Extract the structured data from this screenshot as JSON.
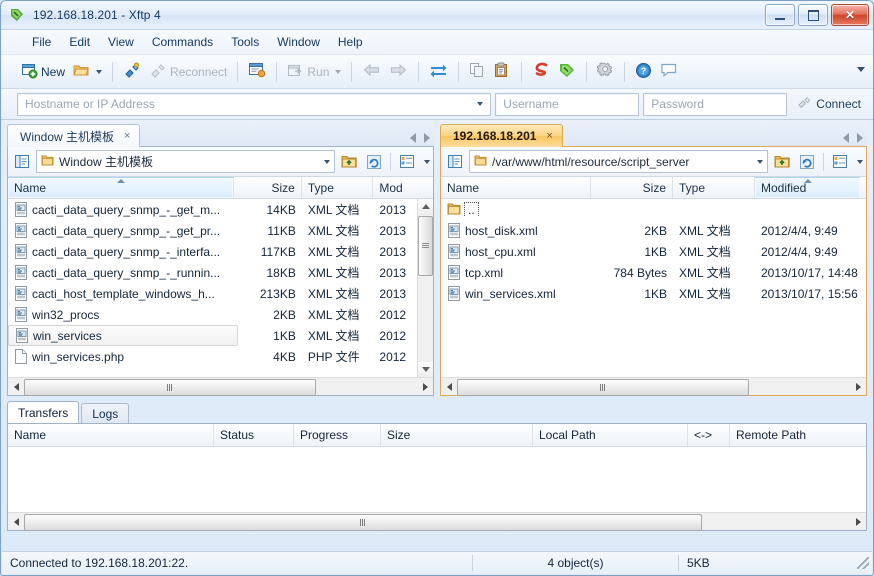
{
  "window": {
    "title": "192.168.18.201 - Xftp 4",
    "icon": "xftp-logo-icon",
    "minimize": "–",
    "maximize": "□",
    "close": "✕"
  },
  "menu": {
    "items": [
      {
        "label": "File"
      },
      {
        "label": "Edit"
      },
      {
        "label": "View"
      },
      {
        "label": "Commands"
      },
      {
        "label": "Tools"
      },
      {
        "label": "Window"
      },
      {
        "label": "Help"
      }
    ]
  },
  "toolbar": {
    "new_label": "New",
    "reconnect_label": "Reconnect",
    "run_label": "Run",
    "icons": {
      "new": "new-session-icon",
      "open": "open-folder-icon",
      "connect": "connect-plug-icon",
      "reconnect": "reconnect-plug-icon",
      "properties": "session-properties-icon",
      "run": "run-icon",
      "back": "back-arrow-icon",
      "forward": "forward-arrow-icon",
      "sync": "sync-transfer-icon",
      "copy": "copy-icon",
      "paste": "paste-icon",
      "xshell": "xshell-icon",
      "xftp": "xftp-icon",
      "options": "gear-options-icon",
      "help": "help-icon",
      "feedback": "chat-feedback-icon",
      "overflow": "toolbar-overflow-icon"
    }
  },
  "connection": {
    "host_placeholder": "Hostname or IP Address",
    "username_placeholder": "Username",
    "password_placeholder": "Password",
    "connect_label": "Connect"
  },
  "local_pane": {
    "tab": {
      "label": "Window 主机模板",
      "close": "×",
      "active": false
    },
    "path": "Window 主机模板",
    "columns": [
      {
        "label": "Name",
        "sorted": true,
        "sort": "asc"
      },
      {
        "label": "Size",
        "sorted": false
      },
      {
        "label": "Type",
        "sorted": false
      },
      {
        "label": "Mod",
        "sorted": false
      }
    ],
    "files": [
      {
        "name": "cacti_data_query_snmp_-_get_m...",
        "size": "14KB",
        "type": "XML 文档",
        "modified": "2013",
        "icon": "xml-file-icon",
        "state": "normal"
      },
      {
        "name": "cacti_data_query_snmp_-_get_pr...",
        "size": "11KB",
        "type": "XML 文档",
        "modified": "2013",
        "icon": "xml-file-icon",
        "state": "normal"
      },
      {
        "name": "cacti_data_query_snmp_-_interfa...",
        "size": "117KB",
        "type": "XML 文档",
        "modified": "2013",
        "icon": "xml-file-icon",
        "state": "normal"
      },
      {
        "name": "cacti_data_query_snmp_-_runnin...",
        "size": "18KB",
        "type": "XML 文档",
        "modified": "2013",
        "icon": "xml-file-icon",
        "state": "normal"
      },
      {
        "name": "cacti_host_template_windows_h...",
        "size": "213KB",
        "type": "XML 文档",
        "modified": "2013",
        "icon": "xml-file-icon",
        "state": "normal"
      },
      {
        "name": "win32_procs",
        "size": "2KB",
        "type": "XML 文档",
        "modified": "2012",
        "icon": "xml-file-icon",
        "state": "normal"
      },
      {
        "name": "win_services",
        "size": "1KB",
        "type": "XML 文档",
        "modified": "2012",
        "icon": "xml-file-icon",
        "state": "hover"
      },
      {
        "name": "win_services.php",
        "size": "4KB",
        "type": "PHP 文件",
        "modified": "2012",
        "icon": "php-file-icon",
        "state": "normal"
      }
    ]
  },
  "remote_pane": {
    "tab": {
      "label": "192.168.18.201",
      "close": "×",
      "active": true
    },
    "path": "/var/www/html/resource/script_server",
    "columns": [
      {
        "label": "Name",
        "sorted": false
      },
      {
        "label": "Size",
        "sorted": false
      },
      {
        "label": "Type",
        "sorted": false
      },
      {
        "label": "Modified",
        "sorted": true,
        "sort": "asc"
      }
    ],
    "files": [
      {
        "name": "..",
        "size": "",
        "type": "",
        "modified": "",
        "icon": "parent-folder-icon",
        "state": "focused"
      },
      {
        "name": "host_disk.xml",
        "size": "2KB",
        "type": "XML 文档",
        "modified": "2012/4/4, 9:49",
        "icon": "xml-file-icon",
        "state": "normal"
      },
      {
        "name": "host_cpu.xml",
        "size": "1KB",
        "type": "XML 文档",
        "modified": "2012/4/4, 9:49",
        "icon": "xml-file-icon",
        "state": "normal"
      },
      {
        "name": "tcp.xml",
        "size": "784 Bytes",
        "type": "XML 文档",
        "modified": "2013/10/17, 14:48",
        "icon": "xml-file-icon",
        "state": "normal"
      },
      {
        "name": "win_services.xml",
        "size": "1KB",
        "type": "XML 文档",
        "modified": "2013/10/17, 15:56",
        "icon": "xml-file-icon",
        "state": "normal"
      }
    ]
  },
  "bottom_panel": {
    "tabs": [
      {
        "label": "Transfers",
        "active": true
      },
      {
        "label": "Logs",
        "active": false
      }
    ],
    "columns": [
      {
        "label": "Name"
      },
      {
        "label": "Status"
      },
      {
        "label": "Progress"
      },
      {
        "label": "Size"
      },
      {
        "label": "Local Path"
      },
      {
        "label": "<->"
      },
      {
        "label": "Remote Path"
      }
    ],
    "rows": []
  },
  "statusbar": {
    "connection": "Connected to 192.168.18.201:22.",
    "objects": "4 object(s)",
    "size": "5KB"
  },
  "colors": {
    "active_tab": "#f9c65f",
    "active_pane_border": "#e0a95a",
    "sort_column": "#dceefb",
    "close_button": "#cf4529",
    "window_bg": "#dce9f8"
  }
}
